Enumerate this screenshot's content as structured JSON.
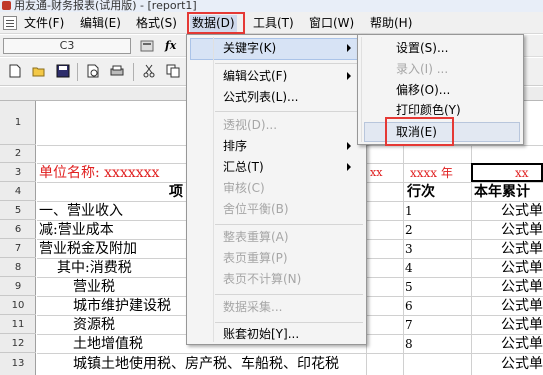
{
  "window": {
    "title": "用友通-财务报表(试用版) - [report1]"
  },
  "menubar": {
    "items": [
      {
        "label": "文件(F)"
      },
      {
        "label": "编辑(E)"
      },
      {
        "label": "格式(S)"
      },
      {
        "label": "数据(D)"
      },
      {
        "label": "工具(T)"
      },
      {
        "label": "窗口(W)"
      },
      {
        "label": "帮助(H)"
      }
    ],
    "active_item": "数据(D)"
  },
  "formula_bar": {
    "cell_ref": "C3",
    "fx_label": "fx"
  },
  "grid": {
    "column_header_visible": "C",
    "rows": [
      "1",
      "2",
      "3",
      "4",
      "5",
      "6",
      "7",
      "8",
      "9",
      "10",
      "11",
      "12",
      "13"
    ],
    "cells": {
      "r3_unit": "单位名称: xxxxxxx",
      "r3_mid": "xx",
      "r3_year": "xxxx 年",
      "r3_right": "xx",
      "r4_item": "项",
      "r4_line": "行次",
      "r4_cum": "本年累计",
      "r5_item": "一、营业收入",
      "r6_item": "减:营业成本",
      "r7_item": "营业税金及附加",
      "r8_item": "其中:消费税",
      "r9_item": "营业税",
      "r10_item": "城市维护建设税",
      "r11_item": "资源税",
      "r12_item": "土地增值税",
      "r13_item": "城镇土地使用税、房产税、车船税、印花税",
      "r5_line": "1",
      "r6_line": "2",
      "r7_line": "3",
      "r8_line": "4",
      "r9_line": "5",
      "r10_line": "6",
      "r11_line": "7",
      "r12_line": "8",
      "formula": "公式单"
    }
  },
  "data_menu": {
    "items": [
      {
        "label": "关键字(K)",
        "submenu": true,
        "disabled": false
      },
      {
        "label": "编辑公式(F)",
        "submenu": true,
        "disabled": false
      },
      {
        "label": "公式列表(L)...",
        "submenu": false,
        "disabled": false
      },
      {
        "label": "透视(D)...",
        "submenu": false,
        "disabled": true
      },
      {
        "label": "排序",
        "submenu": true,
        "disabled": false
      },
      {
        "label": "汇总(T)",
        "submenu": true,
        "disabled": false
      },
      {
        "label": "审核(C)",
        "submenu": false,
        "disabled": true
      },
      {
        "label": "舍位平衡(B)",
        "submenu": false,
        "disabled": true
      },
      {
        "label": "整表重算(A)",
        "submenu": false,
        "disabled": true
      },
      {
        "label": "表页重算(P)",
        "submenu": false,
        "disabled": true
      },
      {
        "label": "表页不计算(N)",
        "submenu": false,
        "disabled": true
      },
      {
        "label": "数据采集...",
        "submenu": false,
        "disabled": true
      },
      {
        "label": "账套初始[Y]...",
        "submenu": false,
        "disabled": false
      }
    ]
  },
  "keyword_submenu": {
    "items": [
      {
        "label": "设置(S)...",
        "disabled": false
      },
      {
        "label": "录入(I) ...",
        "disabled": true
      },
      {
        "label": "偏移(O)...",
        "disabled": false
      },
      {
        "label": "打印颜色(Y)",
        "disabled": false
      },
      {
        "label": "取消(E)",
        "disabled": false
      }
    ]
  },
  "colors": {
    "highlight_box": "#e53935",
    "red_text": "#e02020",
    "menu_active": "#cfd9ec"
  }
}
